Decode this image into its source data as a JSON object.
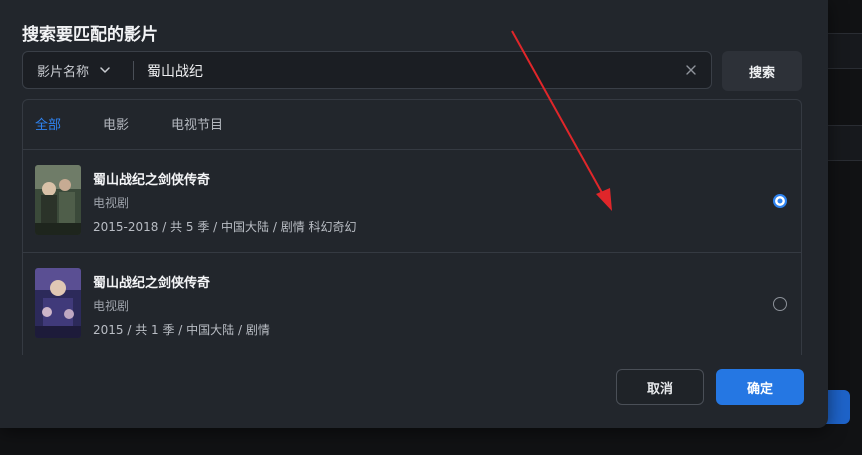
{
  "dialog": {
    "title": "搜索要匹配的影片",
    "search": {
      "type_selected": "影片名称",
      "query": "蜀山战纪",
      "button_label": "搜索"
    },
    "tabs": [
      {
        "label": "全部",
        "active": true
      },
      {
        "label": "电影",
        "active": false
      },
      {
        "label": "电视节目",
        "active": false
      }
    ],
    "results": [
      {
        "title": "蜀山战纪之剑侠传奇",
        "type": "电视剧",
        "meta": "2015-2018 / 共 5 季 / 中国大陆 / 剧情 科幻奇幻",
        "selected": true
      },
      {
        "title": "蜀山战纪之剑侠传奇",
        "type": "电视剧",
        "meta": "2015 / 共 1 季 / 中国大陆 / 剧情",
        "selected": false
      }
    ],
    "footer": {
      "cancel_label": "取消",
      "ok_label": "确定"
    }
  },
  "colors": {
    "accent": "#2577e3",
    "annotation_arrow": "#e0262a"
  },
  "icons": {
    "dropdown": "chevron-down-icon",
    "clear": "close-icon"
  }
}
